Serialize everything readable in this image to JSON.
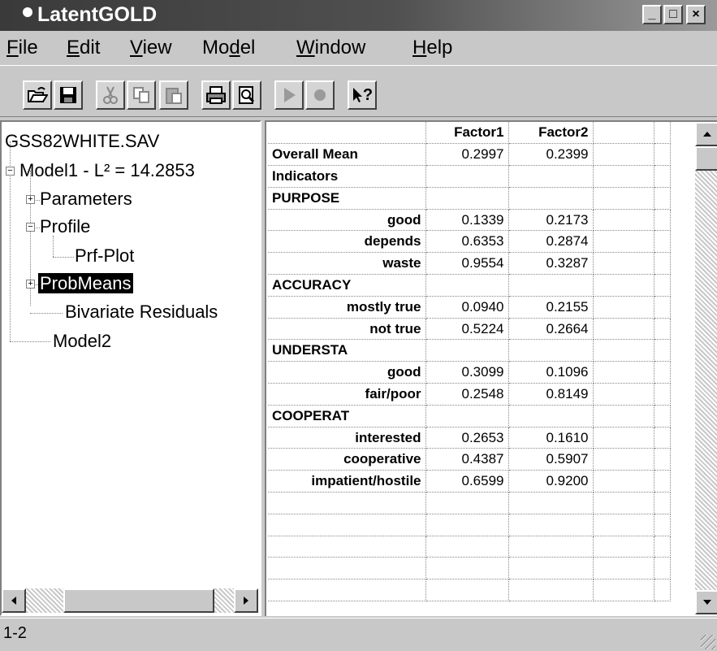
{
  "window": {
    "title": "LatentGOLD"
  },
  "title_buttons": {
    "minimize": "_",
    "maximize": "□",
    "close": "×"
  },
  "menu": [
    {
      "accel": "F",
      "rest": "ile"
    },
    {
      "accel": "E",
      "rest": "dit"
    },
    {
      "accel": "V",
      "rest": "iew"
    },
    {
      "accel": "",
      "pre": "Mo",
      "accel2": "d",
      "rest": "el"
    },
    {
      "accel": "W",
      "rest": "indow"
    },
    {
      "accel": "H",
      "rest": "elp"
    }
  ],
  "toolbar": {
    "buttons": [
      "open-icon",
      "save-icon",
      "cut-icon",
      "copy-icon",
      "paste-icon",
      "print-icon",
      "print-preview-icon",
      "run-icon",
      "stop-icon",
      "context-help-icon"
    ],
    "help_label": "?"
  },
  "tree": {
    "root": "GSS82WHITE.SAV",
    "model1": "Model1 - L² = 14.2853",
    "parameters": "Parameters",
    "profile": "Profile",
    "prf_plot": "Prf-Plot",
    "probmeans": "ProbMeans",
    "bivariate": "Bivariate Residuals",
    "model2": "Model2",
    "expander_plus": "+",
    "expander_minus": "−"
  },
  "table": {
    "headers": [
      "",
      "Factor1",
      "Factor2",
      "",
      ""
    ],
    "rows": [
      {
        "label": "Overall Mean",
        "align": "left",
        "f1": "0.2997",
        "f2": "0.2399"
      },
      {
        "label": "Indicators",
        "align": "left",
        "f1": "",
        "f2": ""
      },
      {
        "label": "PURPOSE",
        "align": "left",
        "f1": "",
        "f2": ""
      },
      {
        "label": "good",
        "align": "right",
        "f1": "0.1339",
        "f2": "0.2173"
      },
      {
        "label": "depends",
        "align": "right",
        "f1": "0.6353",
        "f2": "0.2874"
      },
      {
        "label": "waste",
        "align": "right",
        "f1": "0.9554",
        "f2": "0.3287"
      },
      {
        "label": "ACCURACY",
        "align": "left",
        "f1": "",
        "f2": ""
      },
      {
        "label": "mostly true",
        "align": "right",
        "f1": "0.0940",
        "f2": "0.2155"
      },
      {
        "label": "not true",
        "align": "right",
        "f1": "0.5224",
        "f2": "0.2664"
      },
      {
        "label": "UNDERSTA",
        "align": "left",
        "f1": "",
        "f2": ""
      },
      {
        "label": "good",
        "align": "right",
        "f1": "0.3099",
        "f2": "0.1096"
      },
      {
        "label": "fair/poor",
        "align": "right",
        "f1": "0.2548",
        "f2": "0.8149"
      },
      {
        "label": "COOPERAT",
        "align": "left",
        "f1": "",
        "f2": ""
      },
      {
        "label": "interested",
        "align": "right",
        "f1": "0.2653",
        "f2": "0.1610"
      },
      {
        "label": "cooperative",
        "align": "right",
        "f1": "0.4387",
        "f2": "0.5907"
      },
      {
        "label": "impatient/hostile",
        "align": "right",
        "f1": "0.6599",
        "f2": "0.9200"
      },
      {
        "label": "",
        "align": "left",
        "f1": "",
        "f2": ""
      },
      {
        "label": "",
        "align": "left",
        "f1": "",
        "f2": ""
      },
      {
        "label": "",
        "align": "left",
        "f1": "",
        "f2": ""
      },
      {
        "label": "",
        "align": "left",
        "f1": "",
        "f2": ""
      },
      {
        "label": "",
        "align": "left",
        "f1": "",
        "f2": ""
      }
    ]
  },
  "status": {
    "text": "1-2"
  },
  "colors": {
    "chrome": "#c8c8c8",
    "title_dark": "#3a3a3a",
    "selection": "#000000"
  }
}
